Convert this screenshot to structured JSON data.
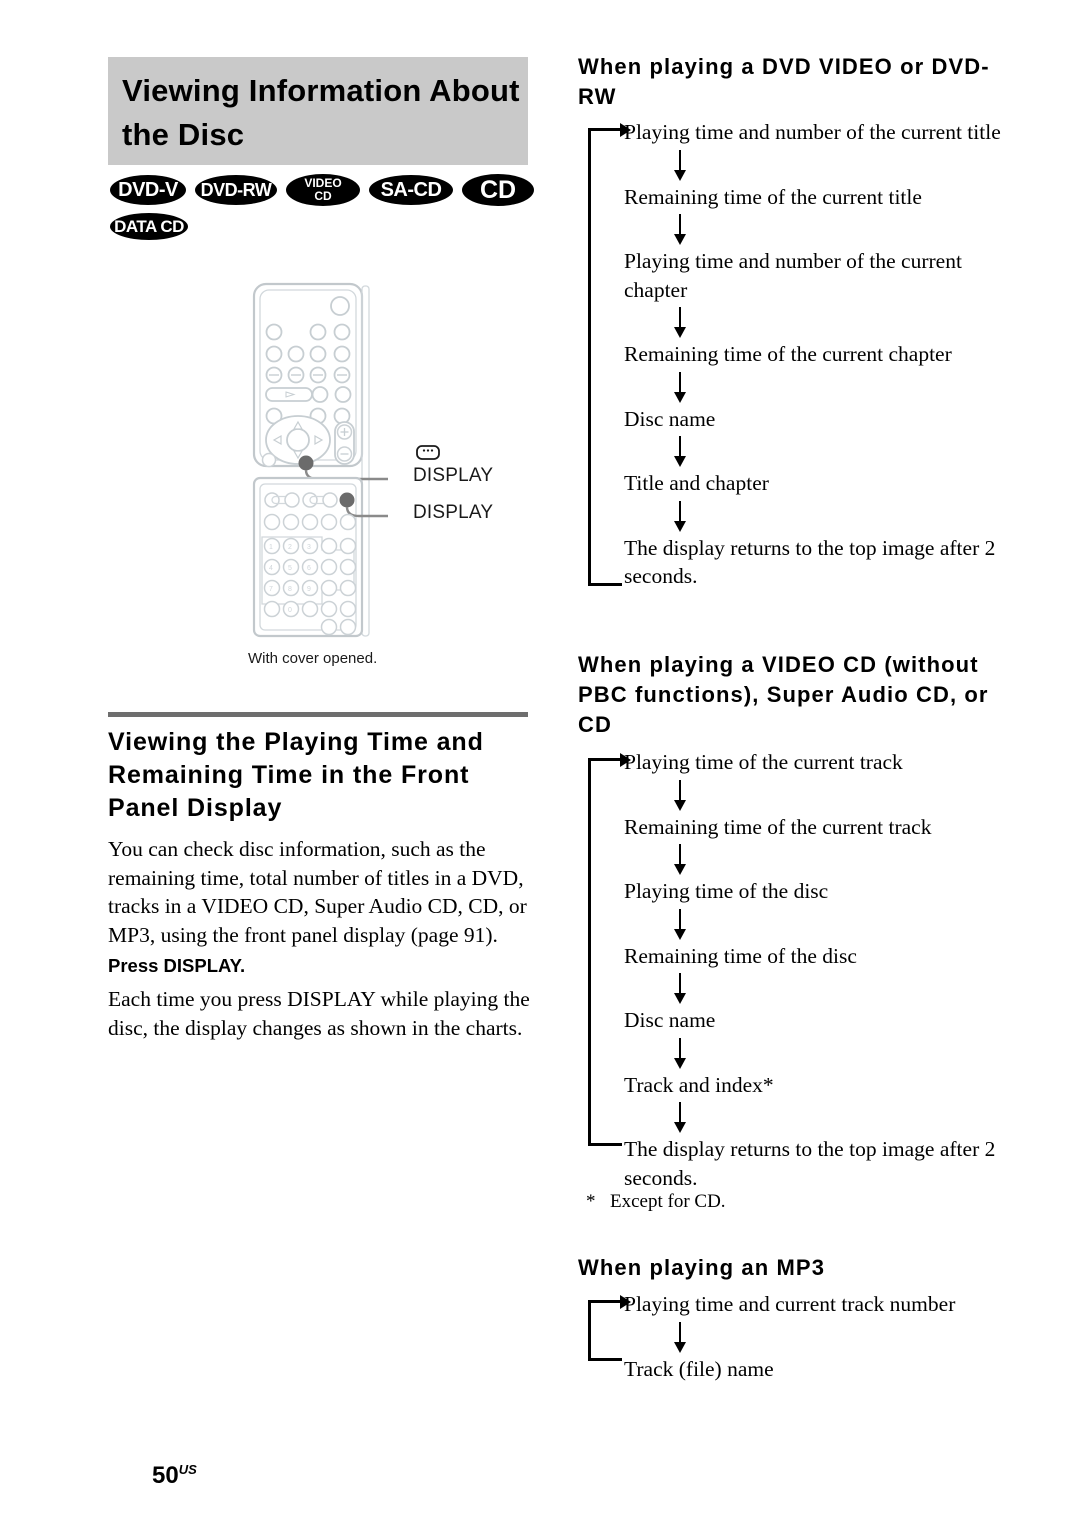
{
  "page": {
    "number": "50",
    "region_suffix": "US"
  },
  "left": {
    "title_line1": "Viewing Information About",
    "title_line2": "the Disc",
    "badges": [
      {
        "id": "dvd-v",
        "label": "DVD-V"
      },
      {
        "id": "dvd-rw",
        "label": "DVD-RW"
      },
      {
        "id": "video-cd",
        "label_line1": "VIDEO",
        "label_line2": "CD"
      },
      {
        "id": "sa-cd",
        "label": "SA-CD"
      },
      {
        "id": "cd",
        "label": "CD"
      },
      {
        "id": "data-cd",
        "label": "DATA CD"
      }
    ],
    "remote": {
      "caption": "With cover opened.",
      "callout_1": "DISPLAY",
      "callout_2": "DISPLAY"
    },
    "section_heading": "Viewing the Playing Time and Remaining Time in the Front Panel Display",
    "paragraph_1": "You can check disc information, such as the remaining time, total number of titles in a DVD, tracks in a VIDEO CD, Super Audio CD, CD, or MP3, using the front panel display (page 91).",
    "bold_lead": "Press DISPLAY.",
    "paragraph_2": "Each time you press DISPLAY while playing the disc, the display changes as shown in the charts."
  },
  "right": {
    "dvd": {
      "heading": "When playing a DVD VIDEO or DVD-RW",
      "steps": [
        "Playing time and number of the current title",
        "Remaining time of the current title",
        "Playing time and number of the current chapter",
        "Remaining time of the current chapter",
        "Disc name",
        "Title and chapter",
        "The display returns to the top image after 2 seconds."
      ]
    },
    "video_cd": {
      "heading": "When playing a VIDEO CD (without PBC functions), Super Audio CD, or CD",
      "steps": [
        "Playing time of the current track",
        "Remaining time of the current track",
        "Playing time of the disc",
        "Remaining time of the disc",
        "Disc name",
        "Track and index*",
        "The display returns to the top image after 2 seconds."
      ],
      "footnote_marker": "*",
      "footnote_text": "Except for CD."
    },
    "mp3": {
      "heading": "When playing an MP3",
      "steps": [
        "Playing time and current track number",
        "Track (file) name"
      ]
    }
  },
  "colors": {
    "banner_gray": "#c9c9c9",
    "rule_gray": "#6e6e6e",
    "badge_black": "#000000",
    "text_black": "#000000"
  }
}
